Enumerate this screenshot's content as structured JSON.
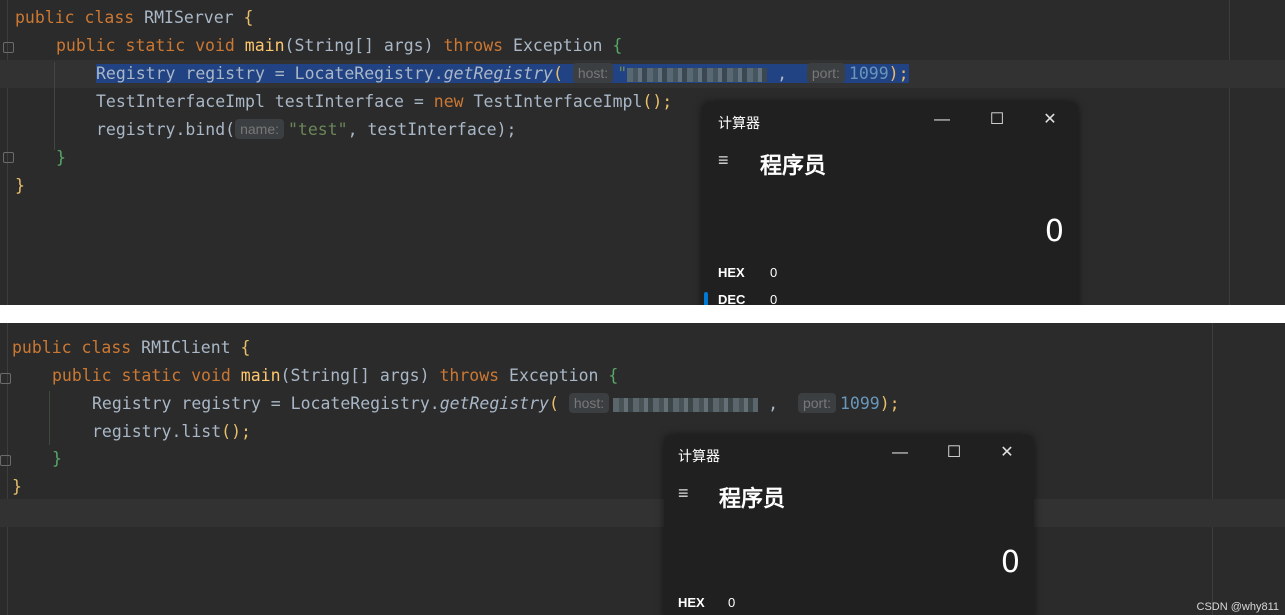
{
  "top": {
    "lines": {
      "l1": {
        "kw1": "public",
        "kw2": "class",
        "name": "RMIServer",
        "brace": "{"
      },
      "l2": {
        "kw1": "public",
        "kw2": "static",
        "kw3": "void",
        "fn": "main",
        "args": "(String[] args)",
        "throws": "throws",
        "exc": "Exception",
        "brace": "{"
      },
      "l3": {
        "pre": "Registry registry = LocateRegistry.",
        "method": "getRegistry",
        "open": "(",
        "hint_host": "host:",
        "quote": "\"",
        "comma": ",",
        "hint_port": "port:",
        "port": "1099",
        "close": ");"
      },
      "l4": {
        "pre": "TestInterfaceImpl testInterface = ",
        "new": "new",
        "cls": "TestInterfaceImpl",
        "paren": "();"
      },
      "l5": {
        "pre": "registry.bind(",
        "hint_name": "name:",
        "str": "\"test\"",
        "rest": ", testInterface);"
      },
      "l6": {
        "brace": "}"
      },
      "l7": {
        "brace": "}"
      }
    },
    "calc": {
      "title": "计算器",
      "mode": "程序员",
      "display": "0",
      "hex_label": "HEX",
      "hex_val": "0",
      "dec_label": "DEC",
      "dec_val": "0",
      "min": "—",
      "max": "☐",
      "close": "✕",
      "menu": "≡"
    }
  },
  "bottom": {
    "lines": {
      "l1": {
        "kw1": "public",
        "kw2": "class",
        "name": "RMIClient",
        "brace": "{"
      },
      "l2": {
        "kw1": "public",
        "kw2": "static",
        "kw3": "void",
        "fn": "main",
        "args": "(String[] args)",
        "throws": "throws",
        "exc": "Exception",
        "brace": "{"
      },
      "l3": {
        "pre": "Registry registry = LocateRegistry.",
        "method": "getRegistry",
        "open": "(",
        "hint_host": "host:",
        "comma": ",",
        "hint_port": "port:",
        "port": "1099",
        "close": ");"
      },
      "l4": {
        "pre": "registry.list",
        "paren": "();"
      },
      "l5": {
        "brace": "}"
      },
      "l6": {
        "brace": "}"
      }
    },
    "calc": {
      "title": "计算器",
      "mode": "程序员",
      "display": "0",
      "hex_label": "HEX",
      "hex_val": "0",
      "min": "—",
      "max": "☐",
      "close": "✕",
      "menu": "≡"
    }
  },
  "watermark": "CSDN @why811"
}
